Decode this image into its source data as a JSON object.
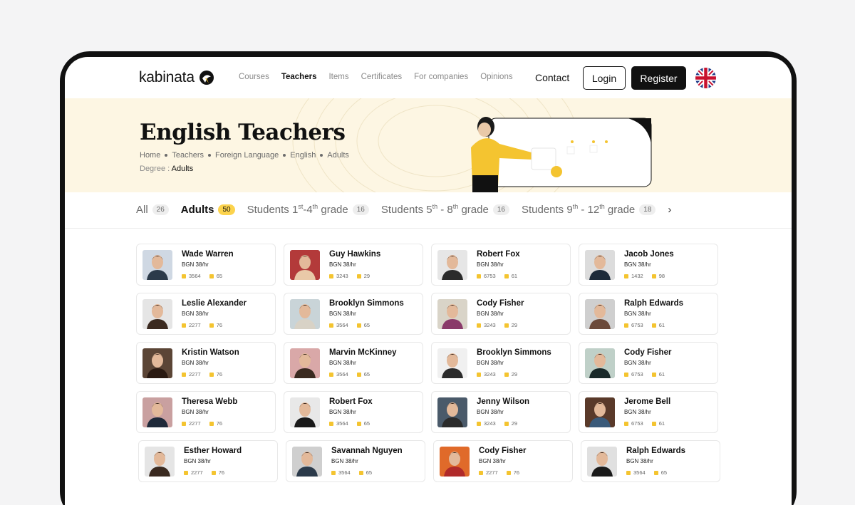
{
  "header": {
    "logo": "kabinata",
    "nav": [
      "Courses",
      "Teachers",
      "Items",
      "Certificates",
      "For companies",
      "Opinions"
    ],
    "active_nav": "Teachers",
    "contact": "Contact",
    "login": "Login",
    "register": "Register"
  },
  "hero": {
    "title": "English Teachers",
    "breadcrumbs": [
      "Home",
      "Teachers",
      "Foreign Language",
      "English",
      "Adults"
    ],
    "degree_label": "Degree :",
    "degree_value": "Adults"
  },
  "tabs": [
    {
      "label": "All",
      "count": "26"
    },
    {
      "label": "Adults",
      "count": "50"
    },
    {
      "label": "Students 1st-4th grade",
      "count": "16"
    },
    {
      "label": "Students 5th - 8th grade",
      "count": "16"
    },
    {
      "label": "Students 9th - 12th grade",
      "count": "18"
    }
  ],
  "colors": {
    "hero_bg": "#fdf6e3",
    "accent": "#fcd34d",
    "dark": "#111111"
  },
  "teachers": [
    {
      "name": "Wade Warren",
      "price": "BGN 38/hr",
      "lessons": "3564",
      "reviews": "65"
    },
    {
      "name": "Guy Hawkins",
      "price": "BGN 38/hr",
      "lessons": "3243",
      "reviews": "29"
    },
    {
      "name": "Robert Fox",
      "price": "BGN 38/hr",
      "lessons": "6753",
      "reviews": "61"
    },
    {
      "name": "Jacob Jones",
      "price": "BGN 38/hr",
      "lessons": "1432",
      "reviews": "98"
    },
    {
      "name": "Leslie Alexander",
      "price": "BGN 38/hr",
      "lessons": "2277",
      "reviews": "76"
    },
    {
      "name": "Brooklyn Simmons",
      "price": "BGN 38/hr",
      "lessons": "3564",
      "reviews": "65"
    },
    {
      "name": "Cody Fisher",
      "price": "BGN 38/hr",
      "lessons": "3243",
      "reviews": "29"
    },
    {
      "name": "Ralph Edwards",
      "price": "BGN 38/hr",
      "lessons": "6753",
      "reviews": "61"
    },
    {
      "name": "Kristin Watson",
      "price": "BGN 38/hr",
      "lessons": "2277",
      "reviews": "76"
    },
    {
      "name": "Marvin McKinney",
      "price": "BGN 38/hr",
      "lessons": "3564",
      "reviews": "65"
    },
    {
      "name": "Brooklyn Simmons",
      "price": "BGN 38/hr",
      "lessons": "3243",
      "reviews": "29"
    },
    {
      "name": "Cody Fisher",
      "price": "BGN 38/hr",
      "lessons": "6753",
      "reviews": "61"
    },
    {
      "name": "Theresa Webb",
      "price": "BGN 38/hr",
      "lessons": "2277",
      "reviews": "76"
    },
    {
      "name": "Robert Fox",
      "price": "BGN 38/hr",
      "lessons": "3564",
      "reviews": "65"
    },
    {
      "name": "Jenny Wilson",
      "price": "BGN 38/hr",
      "lessons": "3243",
      "reviews": "29"
    },
    {
      "name": "Jerome Bell",
      "price": "BGN 38/hr",
      "lessons": "6753",
      "reviews": "61"
    },
    {
      "name": "Esther Howard",
      "price": "BGN 38/hr",
      "lessons": "2277",
      "reviews": "76"
    },
    {
      "name": "Savannah Nguyen",
      "price": "BGN 38/hr",
      "lessons": "3564",
      "reviews": "65"
    },
    {
      "name": "Cody Fisher",
      "price": "BGN 38/hr",
      "lessons": "2277",
      "reviews": "76"
    },
    {
      "name": "Ralph Edwards",
      "price": "BGN 38/hr",
      "lessons": "3564",
      "reviews": "65"
    }
  ]
}
